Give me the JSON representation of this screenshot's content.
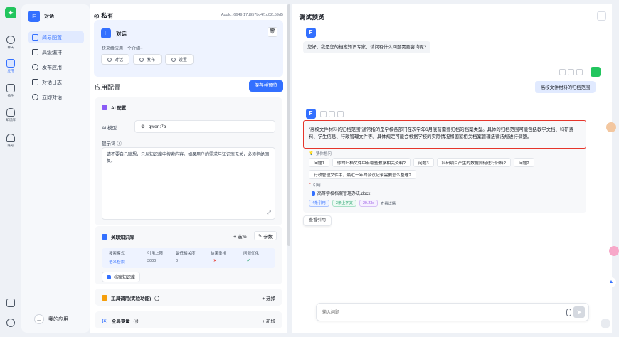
{
  "rail": {
    "items": [
      {
        "label": "聊天",
        "icon": "chat-icon"
      },
      {
        "label": "应用",
        "icon": "robot-icon"
      },
      {
        "label": "插件",
        "icon": "puzzle-icon"
      },
      {
        "label": "知识库",
        "icon": "database-icon"
      },
      {
        "label": "账号",
        "icon": "user-icon"
      }
    ]
  },
  "nav": {
    "app_name": "对话",
    "items": [
      "简易配置",
      "高级编排",
      "发布应用",
      "对话日志",
      "立即对话"
    ],
    "back_label": "我的应用"
  },
  "config": {
    "privacy": "私有",
    "appid": "AppId: 6649f17d957bc4f1d02c59d5",
    "app_title": "对话",
    "intro": "快来给应用一个介绍~",
    "buttons": [
      "对话",
      "发布",
      "设置"
    ],
    "section_title": "应用配置",
    "save_label": "保存并预览",
    "ai": {
      "title": "AI 配置",
      "model_label": "AI 模型",
      "model": "qwen:7b",
      "prompt_label": "提示词",
      "prompt": "请不要自己联想，只从知识库中搜索内容。如果用户的需求与知识库无关，必须拒绝回复。"
    },
    "kb": {
      "title": "关联知识库",
      "select": "+ 选择",
      "params": "参数",
      "headers": [
        "搜索模式",
        "引用上限",
        "最低相关度",
        "结果重排",
        "问题优化"
      ],
      "values": [
        "语义检索",
        "3000",
        "0",
        "✕",
        "✔"
      ],
      "dataset": "档案知识库"
    },
    "tools": {
      "title": "工具调用(实验功能)",
      "action": "+ 选择"
    },
    "vars": {
      "title": "全局变量",
      "action": "+ 新增"
    }
  },
  "preview": {
    "title": "调试预览",
    "greeting": "您好，我是您的档案知识专家，请问有什么问题需要咨询呢?",
    "user_msg": "高校文件材料的归档范围",
    "answer": "“高校文件材料的归档范围”通常指的是学校各部门在次学年6月底前需要归档的档案类型。具体的归档范围可能包括教学文档、科研资料、学生信息、行政管理文件等。具体规定可能会根据学校的实际情况和国家相关档案管理法律法规进行调整。",
    "guess_label": "猜你想问",
    "guesses": [
      "问题1",
      "你的归档文件中有哪些教学相关资料?",
      "问题3",
      "科研项目产生的数据如何进行归档?",
      "问题2",
      "行政管理文件中，最近一年的会议记录需要怎么整理?"
    ],
    "cite_label": "引用",
    "cite_file": "高等学校档案管理办法.docx",
    "tags": [
      {
        "text": "4条引用",
        "color": "#3370ff"
      },
      {
        "text": "3条上下文",
        "color": "#22a06b"
      },
      {
        "text": "20.23s",
        "color": "#9b5de5"
      }
    ],
    "detail_label": "查看详情",
    "view_cite": "查看引用",
    "input_placeholder": "输入问题"
  }
}
